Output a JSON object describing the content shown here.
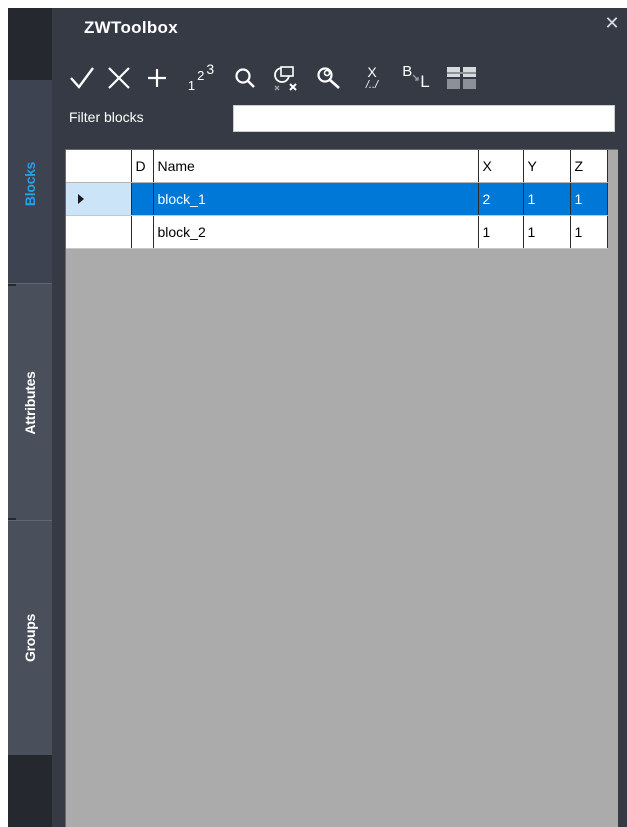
{
  "window": {
    "title": "ZWToolbox",
    "close_glyph": "✕"
  },
  "tabs": [
    {
      "label": "Blocks",
      "active": true
    },
    {
      "label": "Attributes",
      "active": false
    },
    {
      "label": "Groups",
      "active": false
    }
  ],
  "toolbar": {
    "buttons": [
      {
        "name": "check-icon",
        "tooltip": ""
      },
      {
        "name": "cross-icon",
        "tooltip": ""
      },
      {
        "name": "plus-icon",
        "tooltip": ""
      },
      {
        "name": "numbering-icon",
        "glyph": "1²³"
      },
      {
        "name": "zoom-icon"
      },
      {
        "name": "select-clear-icon"
      },
      {
        "name": "find-replace-icon"
      },
      {
        "name": "x-scale-icon",
        "glyph": "X"
      },
      {
        "name": "base-label-icon",
        "glyph": "B L"
      },
      {
        "name": "grid-toggle-icon"
      }
    ],
    "numbering_text": "1",
    "numbering_sup": "2",
    "numbering_sup2": "3",
    "x_text": "X",
    "x_sub": "/../",
    "b_text": "B",
    "l_text": "L"
  },
  "filter": {
    "label": "Filter blocks",
    "value": "",
    "placeholder": ""
  },
  "grid": {
    "columns": [
      "D",
      "Name",
      "X",
      "Y",
      "Z"
    ],
    "rows": [
      {
        "name": "block_1",
        "x": "2",
        "y": "1",
        "z": "1",
        "selected": true
      },
      {
        "name": "block_2",
        "x": "1",
        "y": "1",
        "z": "1",
        "selected": false
      }
    ]
  },
  "colors": {
    "window_bg": "#353a45",
    "tab_active_text": "#24a0e8",
    "selection": "#0078d7",
    "empty_area": "#ababab"
  }
}
